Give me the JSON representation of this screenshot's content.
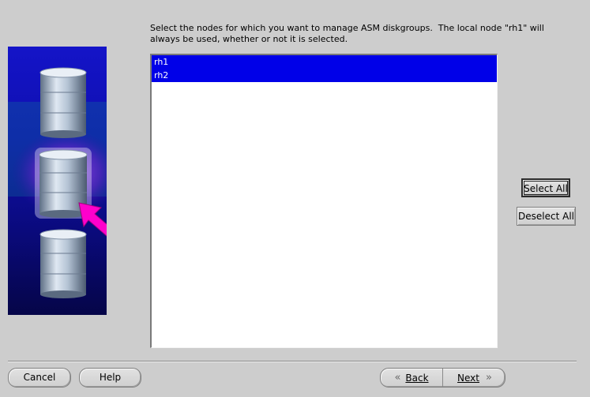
{
  "instructions": "Select the nodes for which you want to manage ASM diskgroups.  The local node \"rh1\" will\nalways be used, whether or not it is selected.",
  "nodes": [
    {
      "name": "rh1",
      "selected": true
    },
    {
      "name": "rh2",
      "selected": true
    }
  ],
  "buttons": {
    "select_all": "Select All",
    "deselect_all": "Deselect All",
    "cancel": "Cancel",
    "help": "Help",
    "back": "Back",
    "next": "Next"
  },
  "icons": {
    "back": "double-chevron-left-icon",
    "next": "double-chevron-right-icon"
  },
  "colors": {
    "selection": "#0000e8",
    "background": "#cdcdcd",
    "arrow": "#ff00cc"
  }
}
